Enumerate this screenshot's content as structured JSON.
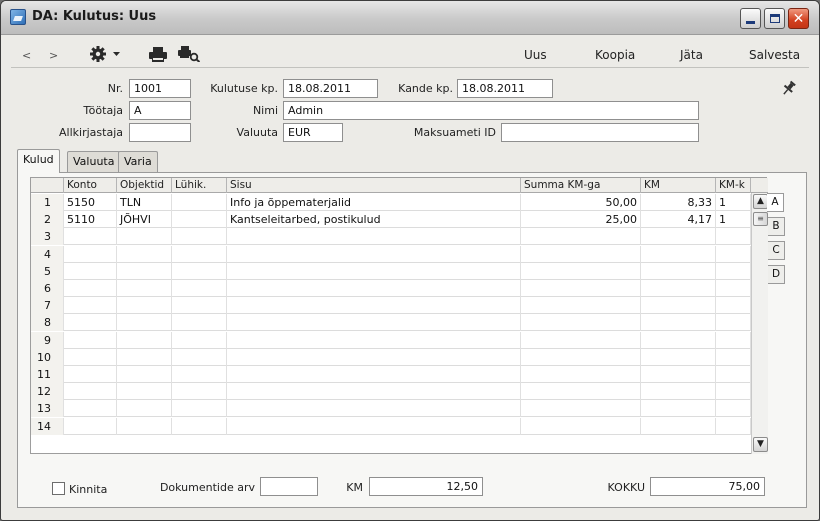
{
  "window": {
    "title": "DA: Kulutus: Uus"
  },
  "toolbar": {
    "prev": "<",
    "next": ">",
    "new_label": "Uus",
    "copy_label": "Koopia",
    "cancel_label": "Jäta",
    "save_label": "Salvesta"
  },
  "header": {
    "nr": {
      "label": "Nr.",
      "value": "1001"
    },
    "expense_date": {
      "label": "Kulutuse kp.",
      "value": "18.08.2011"
    },
    "trans_date": {
      "label": "Kande kp.",
      "value": "18.08.2011"
    },
    "employee": {
      "label": "Töötaja",
      "value": "A"
    },
    "name": {
      "label": "Nimi",
      "value": "Admin"
    },
    "signer": {
      "label": "Allkirjastaja",
      "value": ""
    },
    "currency": {
      "label": "Valuuta",
      "value": "EUR"
    },
    "payment_id": {
      "label": "Maksuameti ID",
      "value": ""
    }
  },
  "tabs": [
    "Kulud",
    "Valuuta",
    "Varia"
  ],
  "grid": {
    "columns": [
      "",
      "Konto",
      "Objektid",
      "Lühik.",
      "Sisu",
      "Summa KM-ga",
      "KM",
      "KM-k"
    ],
    "rows": [
      {
        "n": "1",
        "konto": "5150",
        "objektid": "TLN",
        "lyhik": "",
        "sisu": "Info ja õppematerjalid",
        "summa": "50,00",
        "km": "8,33",
        "kmk": "1"
      },
      {
        "n": "2",
        "konto": "5110",
        "objektid": "JÕHVI",
        "lyhik": "",
        "sisu": "Kantseleitarbed, postikulud",
        "summa": "25,00",
        "km": "4,17",
        "kmk": "1"
      },
      {
        "n": "3"
      },
      {
        "n": "4"
      },
      {
        "n": "5"
      },
      {
        "n": "6"
      },
      {
        "n": "7"
      },
      {
        "n": "8"
      },
      {
        "n": "9"
      },
      {
        "n": "10"
      },
      {
        "n": "11"
      },
      {
        "n": "12"
      },
      {
        "n": "13"
      },
      {
        "n": "14"
      }
    ],
    "page_tabs": [
      "A",
      "B",
      "C",
      "D"
    ]
  },
  "footer": {
    "confirm_label": "Kinnita",
    "documents_label": "Dokumentide arv",
    "documents_value": "",
    "km_label": "KM",
    "km_value": "12,50",
    "total_label": "KOKKU",
    "total_value": "75,00"
  },
  "icons": {
    "app": "app-window-icon",
    "settings": "gear-icon",
    "print": "printer-icon",
    "preview": "print-preview-icon",
    "pin": "pin-icon",
    "scroll_up": "arrow-up-icon",
    "scroll_down": "arrow-down-icon"
  },
  "colors": {
    "close_button": "#d2401f",
    "window_bg": "#ecebe7"
  }
}
